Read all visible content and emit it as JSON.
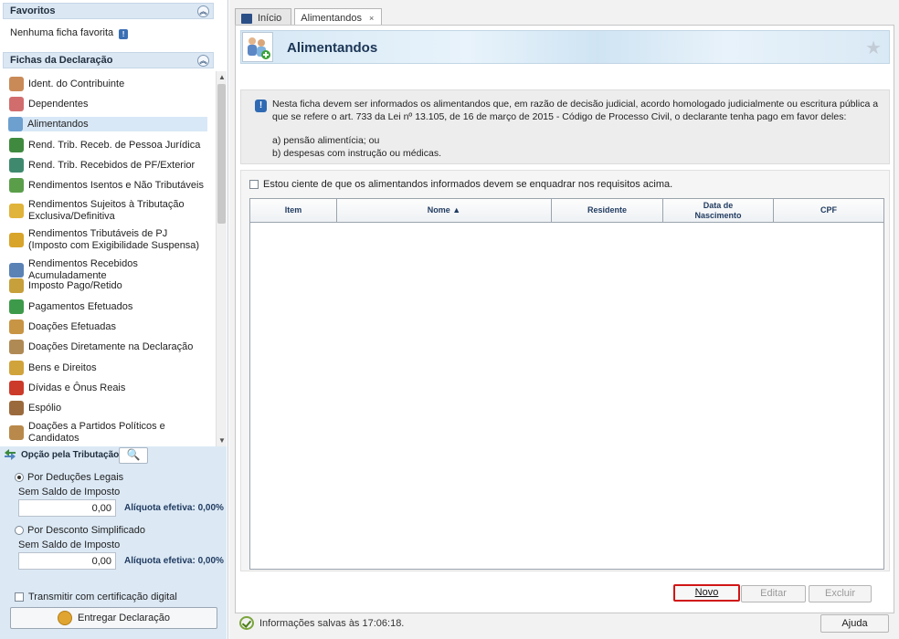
{
  "favoritos": {
    "title": "Favoritos",
    "empty_text": "Nenhuma ficha favorita"
  },
  "fichas": {
    "title": "Fichas da Declaração",
    "items": [
      {
        "label": "Ident. do Contribuinte",
        "icon": "person-icon",
        "color": "#c98a57"
      },
      {
        "label": "Dependentes",
        "icon": "dependents-icon",
        "color": "#d26d6d"
      },
      {
        "label": "Alimentandos",
        "icon": "alimentandos-icon",
        "color": "#6d9fcf",
        "selected": true
      },
      {
        "label": "Rend. Trib. Receb. de Pessoa Jurídica",
        "icon": "income-pj-icon",
        "color": "#3f8a3f"
      },
      {
        "label": "Rend. Trib. Recebidos de PF/Exterior",
        "icon": "income-pf-icon",
        "color": "#3f8a6f"
      },
      {
        "label": "Rendimentos Isentos e Não Tributáveis",
        "icon": "exempt-income-icon",
        "color": "#5a9e4a"
      },
      {
        "label": "Rendimentos Sujeitos à Tributação Exclusiva/Definitiva",
        "icon": "exclusive-tax-icon",
        "color": "#e0b33a"
      },
      {
        "label": "Rendimentos Tributáveis de PJ (Imposto com Exigibilidade Suspensa)",
        "icon": "suspended-tax-icon",
        "color": "#d8a42a"
      },
      {
        "label": "Rendimentos Recebidos Acumuladamente",
        "icon": "accumulated-income-icon",
        "color": "#5a82b5"
      },
      {
        "label": "Imposto Pago/Retido",
        "icon": "tax-paid-icon",
        "color": "#c7a03c"
      },
      {
        "label": "Pagamentos Efetuados",
        "icon": "payments-icon",
        "color": "#3d9a4a"
      },
      {
        "label": "Doações Efetuadas",
        "icon": "donations-icon",
        "color": "#c89545"
      },
      {
        "label": "Doações Diretamente na Declaração",
        "icon": "direct-donations-icon",
        "color": "#b08a55"
      },
      {
        "label": "Bens e Direitos",
        "icon": "assets-icon",
        "color": "#d1a33b"
      },
      {
        "label": "Dívidas e Ônus Reais",
        "icon": "debts-icon",
        "color": "#cc3a2a"
      },
      {
        "label": "Espólio",
        "icon": "estate-icon",
        "color": "#9b6a3c"
      },
      {
        "label": "Doações a Partidos Políticos e Candidatos",
        "icon": "party-donations-icon",
        "color": "#b8894a"
      }
    ]
  },
  "tributacao": {
    "title": "Opção pela Tributação:",
    "option1": {
      "label": "Por Deduções Legais",
      "sub": "Sem Saldo de Imposto",
      "value": "0,00",
      "aliquota": "Alíquota efetiva: 0,00%"
    },
    "option2": {
      "label": "Por Desconto Simplificado",
      "sub": "Sem Saldo de Imposto",
      "value": "0,00",
      "aliquota": "Alíquota efetiva: 0,00%"
    },
    "transmitir": "Transmitir com certificação digital",
    "entregar": "Entregar Declaração"
  },
  "tabs": [
    {
      "label": "Início"
    },
    {
      "label": "Alimentandos",
      "close": "×"
    }
  ],
  "page": {
    "title": "Alimentandos",
    "notice_main": "Nesta ficha devem ser informados os alimentandos que, em razão de decisão judicial, acordo homologado judicialmente ou escritura pública a que se refere o art. 733 da Lei nº 13.105, de 16 de março de 2015 - Código de Processo Civil, o declarante tenha pago em favor deles:",
    "notice_a": "a) pensão alimentícia; ou",
    "notice_b": "b) despesas com instrução ou médicas.",
    "ack_label": "Estou ciente de que os alimentandos informados devem se enquadrar nos requisitos acima.",
    "table": {
      "headers": [
        "Item",
        "Nome",
        "Residente",
        "Data de Nascimento",
        "CPF"
      ],
      "sort_indicator": "▲"
    },
    "buttons": {
      "novo": "Novo",
      "editar": "Editar",
      "excluir": "Excluir",
      "ajuda": "Ajuda"
    },
    "status": "Informações salvas às 17:06:18."
  },
  "colors": {
    "accent_red": "#d01616",
    "header_blue": "#1b3555"
  }
}
